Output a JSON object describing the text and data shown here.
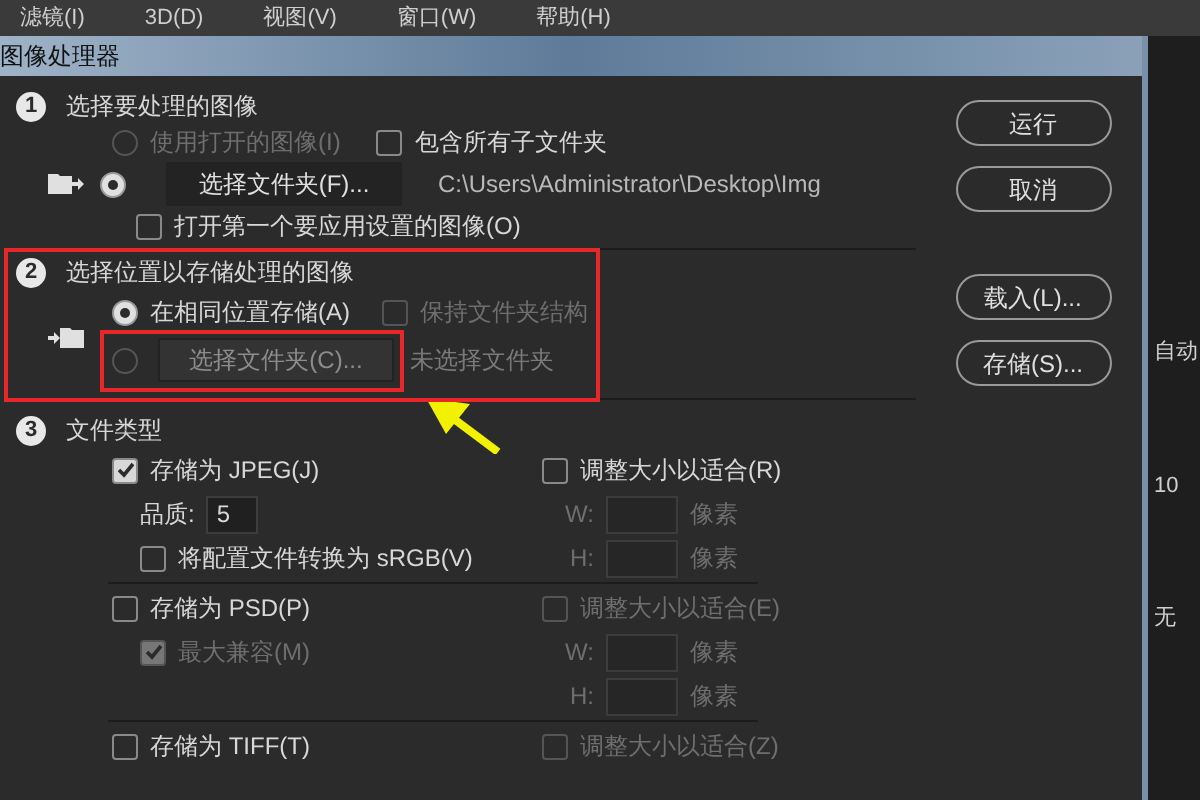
{
  "menu_bar": [
    "滤镜(I)",
    "3D(D)",
    "视图(V)",
    "窗口(W)",
    "帮助(H)"
  ],
  "dialog": {
    "title": "图像处理器",
    "section_1": {
      "number": "1",
      "title": "选择要处理的图像",
      "use_open_images": {
        "label": "使用打开的图像(I)",
        "selected": false,
        "disabled": true
      },
      "include_subfolders": {
        "label": "包含所有子文件夹",
        "checked": false
      },
      "select_folder": {
        "selected": true,
        "button": "选择文件夹(F)...",
        "path": "C:\\Users\\Administrator\\Desktop\\Img"
      },
      "open_first": {
        "label": "打开第一个要应用设置的图像(O)",
        "checked": false
      }
    },
    "section_2": {
      "number": "2",
      "title": "选择位置以存储处理的图像",
      "same_location": {
        "label": "在相同位置存储(A)",
        "selected": true
      },
      "keep_structure": {
        "label": "保持文件夹结构",
        "checked": false,
        "disabled": true
      },
      "select_folder": {
        "selected": false,
        "disabled": true,
        "button": "选择文件夹(C)...",
        "path": "未选择文件夹"
      }
    },
    "section_3": {
      "number": "3",
      "title": "文件类型",
      "formats": [
        {
          "label": "存储为 JPEG(J)",
          "checked": true,
          "resize": {
            "label": "调整大小以适合(R)",
            "checked": false,
            "disabled": false
          },
          "options": [
            {
              "kind": "quality",
              "label": "品质:",
              "value": "5"
            },
            {
              "kind": "checkbox",
              "label": "将配置文件转换为 sRGB(V)",
              "checked": false,
              "disabled": false
            }
          ],
          "fields": [
            {
              "label": "W:",
              "unit": "像素"
            },
            {
              "label": "H:",
              "unit": "像素"
            }
          ]
        },
        {
          "label": "存储为 PSD(P)",
          "checked": false,
          "resize": {
            "label": "调整大小以适合(E)",
            "checked": false,
            "disabled": true
          },
          "options": [
            {
              "kind": "checkbox",
              "label": "最大兼容(M)",
              "checked": true,
              "disabled": true
            }
          ],
          "fields": [
            {
              "label": "W:",
              "unit": "像素"
            },
            {
              "label": "H:",
              "unit": "像素"
            }
          ]
        },
        {
          "label": "存储为 TIFF(T)",
          "checked": false,
          "resize": {
            "label": "调整大小以适合(Z)",
            "checked": false,
            "disabled": true
          }
        }
      ]
    },
    "buttons": [
      {
        "label": "运行"
      },
      {
        "label": "取消"
      },
      {
        "label": "载入(L)..."
      },
      {
        "label": "存储(S)..."
      }
    ]
  },
  "side_panel": [
    "自动",
    "10",
    "无"
  ]
}
